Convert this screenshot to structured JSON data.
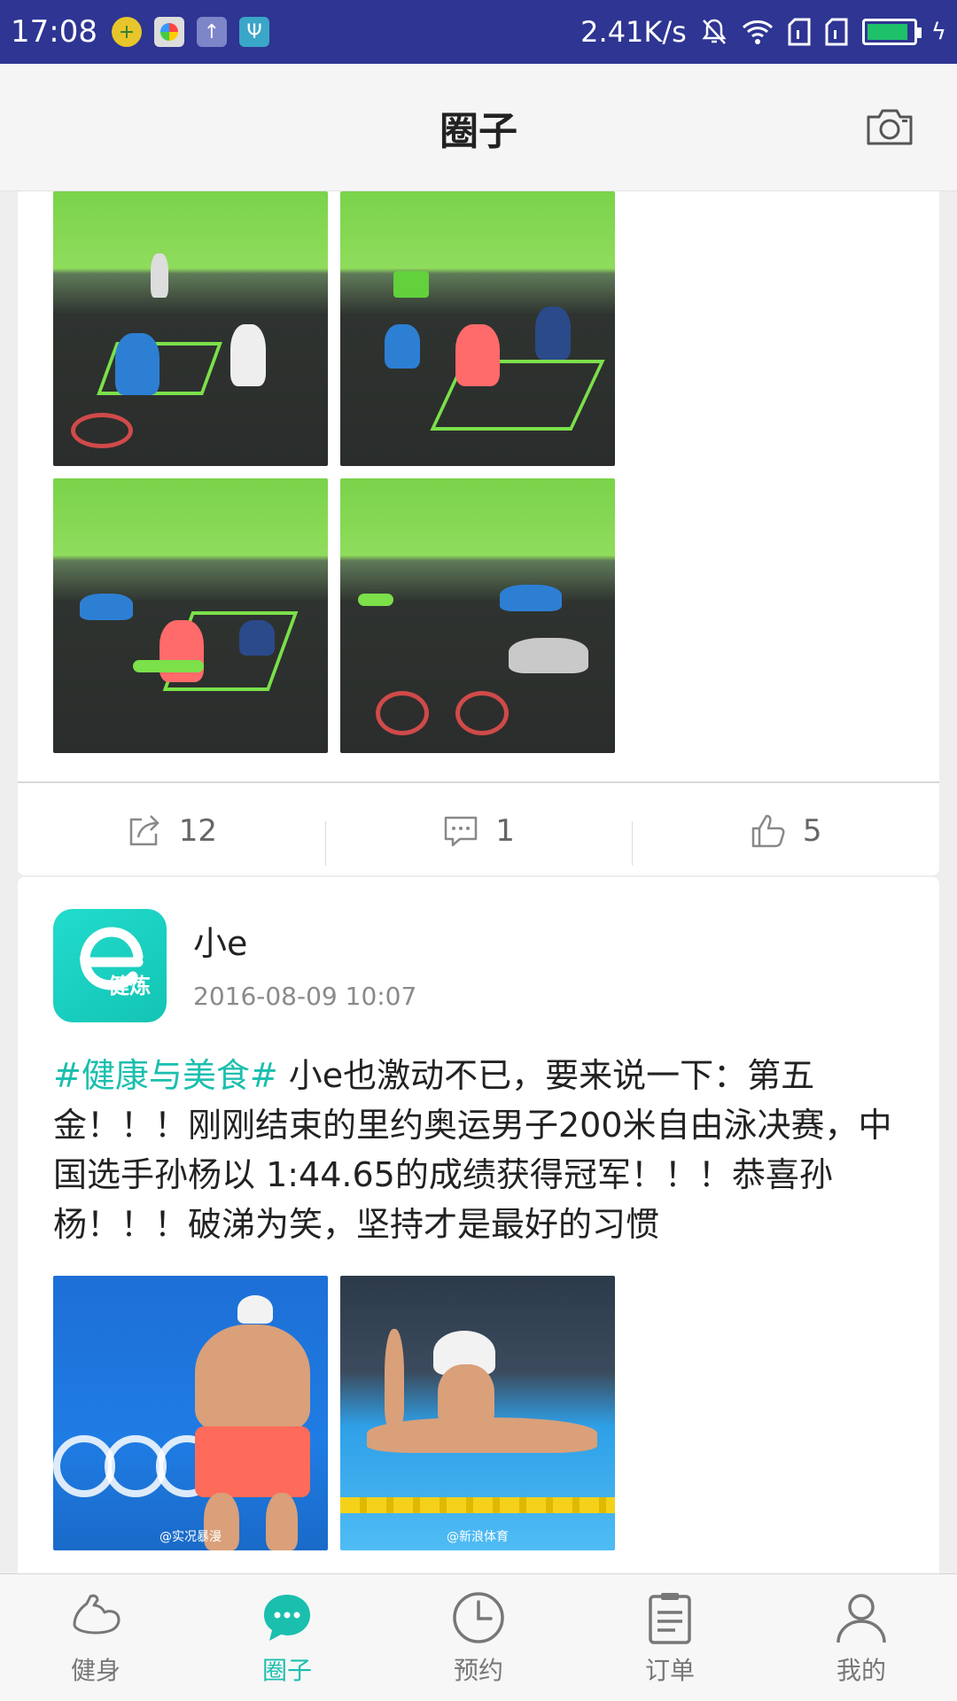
{
  "status_bar": {
    "time": "17:08",
    "network_speed": "2.41K/s",
    "left_icons": [
      "plus-circle-icon",
      "app-icon",
      "upload-icon",
      "usb-icon"
    ],
    "right_icons": [
      "mute-icon",
      "wifi-icon",
      "sim-icon",
      "sim-icon",
      "battery-icon"
    ],
    "battery_level": 0.9
  },
  "header": {
    "title": "圈子",
    "camera_icon": "camera-icon"
  },
  "posts": [
    {
      "images": [
        "gym-photo-1",
        "gym-photo-2",
        "gym-photo-3",
        "gym-photo-4"
      ],
      "share_count": "12",
      "comment_count": "1",
      "like_count": "5"
    },
    {
      "username": "小e",
      "avatar_text": "健炼",
      "timestamp": "2016-08-09 10:07",
      "hashtag": "#健康与美食#",
      "text": "  小e也激动不已，要来说一下：第五金！！！刚刚结束的里约奥运男子200米自由泳决赛，中国选手孙杨以 1:44.65的成绩获得冠军！！！恭喜孙杨！！！破涕为笑，坚持才是最好的习惯",
      "images": [
        "swim-photo-1",
        "swim-photo-2"
      ],
      "watermark_1": "@实况暴漫",
      "watermark_2": "@新浪体育"
    }
  ],
  "bottom_nav": {
    "items": [
      {
        "label": "健身",
        "icon": "muscle-icon",
        "active": false
      },
      {
        "label": "圈子",
        "icon": "chat-bubble-icon",
        "active": true
      },
      {
        "label": "预约",
        "icon": "clock-icon",
        "active": false
      },
      {
        "label": "订单",
        "icon": "order-list-icon",
        "active": false
      },
      {
        "label": "我的",
        "icon": "person-icon",
        "active": false
      }
    ]
  },
  "colors": {
    "status_bar": "#2e3592",
    "accent": "#1bbfae",
    "text_primary": "#222222",
    "text_secondary": "#8a8a8a"
  }
}
